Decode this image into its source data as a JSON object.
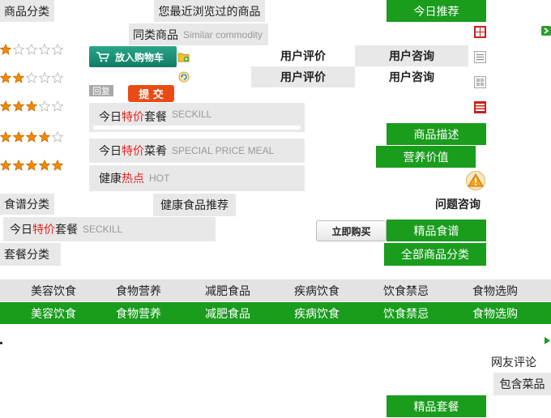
{
  "header": {
    "category_title": "商品分类",
    "recent_viewed": "您最近浏览过的商品",
    "today_recommend": "今日推荐",
    "similar_cn": "同类商品",
    "similar_en": "Similar commodity"
  },
  "ratings": [
    1,
    2,
    3,
    4,
    5
  ],
  "buttons": {
    "add_cart": "放入购物车",
    "reply": "回复",
    "submit": "提 交",
    "buy_now": "立即购买"
  },
  "review_tabs": {
    "user_review": "用户评价",
    "user_consult": "用户咨询"
  },
  "specials": {
    "today": "今日",
    "special": "特价",
    "set_meal": "套餐",
    "seckill": "SECKILL",
    "dish": "菜肴",
    "special_meal_en": "SPECIAL PRICE MEAL",
    "health": "健康",
    "hot": "热点",
    "hot_en": "HOT"
  },
  "right_tabs": {
    "product_desc": "商品描述",
    "nutrition": "营养价值",
    "question_consult": "问题咨询",
    "fine_recipe": "精品食谱",
    "all_categories": "全部商品分类",
    "fine_meal": "精品套餐"
  },
  "left_tabs": {
    "recipe_category": "食谱分类",
    "health_food": "健康食品推荐",
    "meal_category": "套餐分类"
  },
  "nav_bar": [
    "美容饮食",
    "食物营养",
    "减肥食品",
    "疾病饮食",
    "饮食禁忌",
    "食物选购"
  ],
  "bottom": {
    "netizen_comment": "网友评论",
    "contains_dishes": "包含菜品"
  },
  "colors": {
    "green": "#1a9c1d",
    "gray": "#e8e8e8",
    "red_highlight": "#e8211c",
    "star_orange": "#f08a00"
  }
}
